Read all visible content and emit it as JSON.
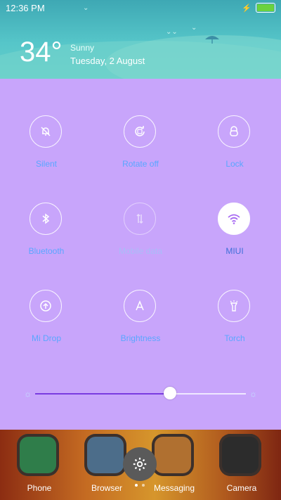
{
  "status_bar": {
    "time": "12:36 PM"
  },
  "weather": {
    "temperature": "34°",
    "condition": "Sunny",
    "date": "Tuesday, 2 August"
  },
  "toggles": [
    {
      "label": "Silent",
      "icon": "bell-off-icon",
      "state": "off"
    },
    {
      "label": "Rotate off",
      "icon": "rotate-icon",
      "state": "off"
    },
    {
      "label": "Lock",
      "icon": "lock-icon",
      "state": "off"
    },
    {
      "label": "Bluetooth",
      "icon": "bluetooth-icon",
      "state": "off"
    },
    {
      "label": "Mobile data",
      "icon": "mobile-data-icon",
      "state": "disabled"
    },
    {
      "label": "MIUI",
      "icon": "wifi-icon",
      "state": "on"
    },
    {
      "label": "Mi Drop",
      "icon": "mi-drop-icon",
      "state": "off"
    },
    {
      "label": "Brightness",
      "icon": "brightness-auto-icon",
      "state": "off"
    },
    {
      "label": "Torch",
      "icon": "torch-icon",
      "state": "off"
    }
  ],
  "brightness": {
    "level": 0.64
  },
  "dock": {
    "apps": [
      {
        "name": "Phone",
        "icon": "phone-icon"
      },
      {
        "name": "Browser",
        "icon": "browser-icon"
      },
      {
        "name": "Messaging",
        "icon": "messaging-icon"
      },
      {
        "name": "Camera",
        "icon": "camera-icon"
      }
    ]
  },
  "colors": {
    "panel": "#c8a5fb",
    "label_blue": "#5aa6ff",
    "weather_top": "#3ea8b4"
  }
}
